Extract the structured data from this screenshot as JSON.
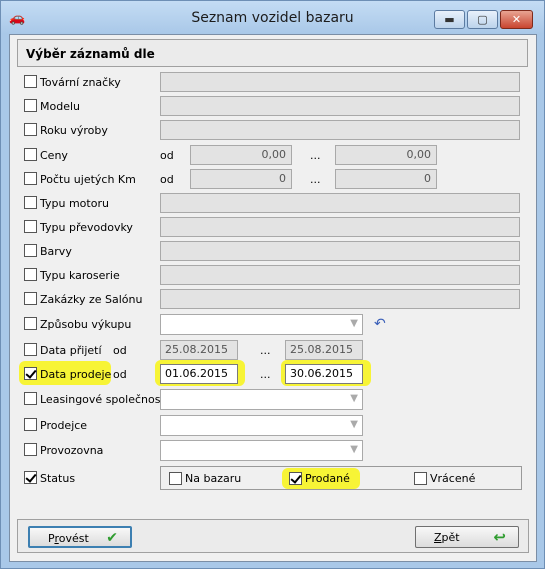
{
  "window": {
    "title": "Seznam vozidel bazaru",
    "icon": "car-icon",
    "controls": {
      "minimize": "▬",
      "maximize": "▢",
      "close": "✕"
    }
  },
  "section_title": "Výběr záznamů dle",
  "filters": [
    {
      "label": "Tovární značky",
      "checked": false
    },
    {
      "label": "Modelu",
      "checked": false
    },
    {
      "label": "Roku výroby",
      "checked": false
    },
    {
      "label": "Ceny",
      "checked": false,
      "od": "od",
      "from": "0,00",
      "to": "0,00",
      "dots": "..."
    },
    {
      "label": "Počtu ujetých Km",
      "checked": false,
      "od": "od",
      "from": "0",
      "to": "0",
      "dots": "..."
    },
    {
      "label": "Typu motoru",
      "checked": false
    },
    {
      "label": "Typu převodovky",
      "checked": false
    },
    {
      "label": "Barvy",
      "checked": false
    },
    {
      "label": "Typu karoserie",
      "checked": false
    },
    {
      "label": "Zakázky ze Salónu",
      "checked": false
    },
    {
      "label": "Způsobu výkupu",
      "checked": false,
      "combo_value": ""
    },
    {
      "label": "Data přijetí",
      "checked": false,
      "od": "od",
      "from": "25.08.2015",
      "to": "25.08.2015",
      "dots": "..."
    },
    {
      "label": "Data prodeje",
      "checked": true,
      "od": "od",
      "from": "01.06.2015",
      "to": "30.06.2015",
      "dots": "..."
    },
    {
      "label": "Leasingové společnosti",
      "checked": false,
      "combo_value": ""
    },
    {
      "label": "Prodejce",
      "checked": false,
      "combo_value": ""
    },
    {
      "label": "Provozovna",
      "checked": false,
      "combo_value": ""
    },
    {
      "label": "Status",
      "checked": true
    }
  ],
  "status_options": [
    {
      "label": "Na bazaru",
      "checked": false
    },
    {
      "label": "Prodané",
      "checked": true
    },
    {
      "label": "Vrácené",
      "checked": false
    }
  ],
  "buttons": {
    "provest": {
      "pre": "P",
      "mnemonic": "r",
      "post": "ovést"
    },
    "zpet": {
      "mnemonic": "Z",
      "post": "pět"
    }
  },
  "colors": {
    "highlight": "#f7f436",
    "title_bar": "#a9c8e8",
    "accent_green": "#2f9c2f"
  }
}
